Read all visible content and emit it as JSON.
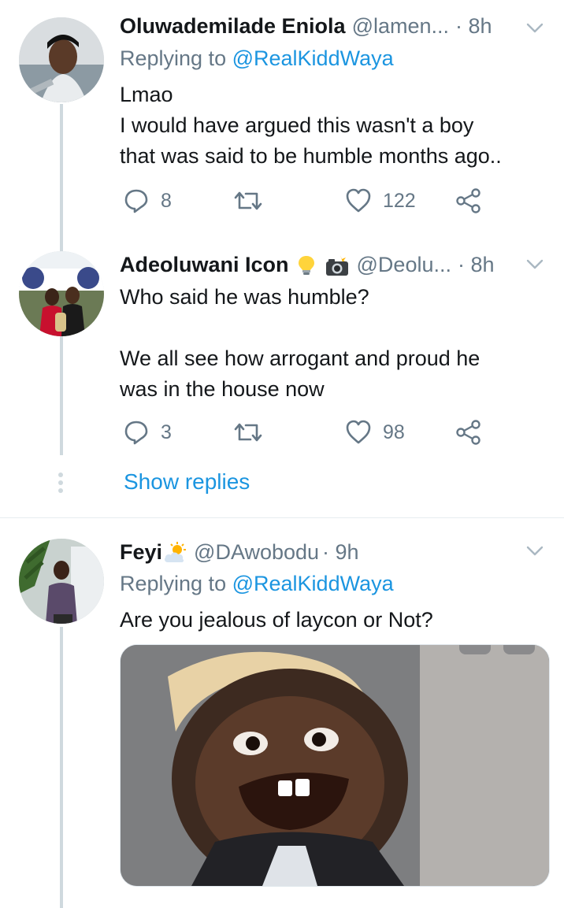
{
  "tweets": [
    {
      "name": "Oluwademilade Eniola",
      "handle": "@lamen...",
      "time": "· 8h",
      "replying_prefix": "Replying to",
      "replying_mention": "@RealKiddWaya",
      "text_lines": [
        "Lmao",
        "I would have argued this wasn't a boy",
        "that was said to be humble months ago.."
      ],
      "replies": "8",
      "retweets": "",
      "likes": "122"
    },
    {
      "name": "Adeoluwani Icon",
      "handle": "@Deolu...",
      "time": "· 8h",
      "text_lines": [
        "Who said he was humble?",
        "",
        "We all see how arrogant and proud he",
        "was in the house now"
      ],
      "replies": "3",
      "retweets": "",
      "likes": "98"
    },
    {
      "name": "Feyi",
      "handle": "@DAwobodu",
      "time": "· 9h",
      "replying_prefix": "Replying to",
      "replying_mention": "@RealKiddWaya",
      "text_lines": [
        "Are you jealous of laycon or Not?"
      ]
    }
  ],
  "show_replies": "Show replies",
  "icons": {
    "reply": "reply-icon",
    "retweet": "retweet-icon",
    "like": "heart-icon",
    "share": "share-icon",
    "more": "chevron-down-icon"
  },
  "colors": {
    "link": "#1b95e0",
    "secondary": "#657786",
    "thread": "#cfd9de"
  }
}
